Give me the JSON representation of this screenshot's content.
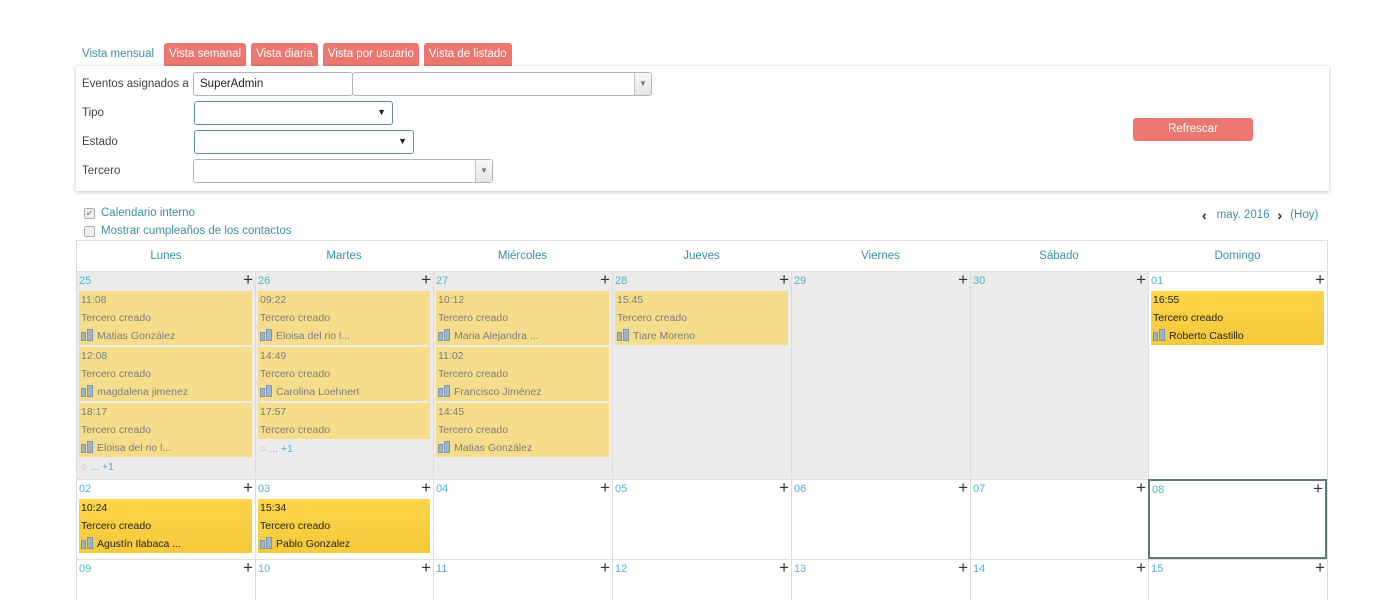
{
  "tabs": [
    {
      "label": "Vista mensual",
      "active": false
    },
    {
      "label": "Vista semanal",
      "active": true
    },
    {
      "label": "Vista diaria",
      "active": true
    },
    {
      "label": "Vista por usuario",
      "active": true
    },
    {
      "label": "Vista de listado",
      "active": true
    }
  ],
  "filters": {
    "assigned_label": "Eventos asignados a",
    "assigned_value": "SuperAdmin",
    "type_label": "Tipo",
    "status_label": "Estado",
    "third_label": "Tercero",
    "refresh_label": "Refrescar"
  },
  "options": {
    "internal_calendar": "Calendario interno",
    "birthdays": "Mostrar cumpleaños de los contactos"
  },
  "nav": {
    "month": "may. 2016",
    "today": "(Hoy)"
  },
  "weekdays": [
    "Lunes",
    "Martes",
    "Miércoles",
    "Jueves",
    "Viernes",
    "Sábado",
    "Domingo"
  ],
  "weeks": [
    [
      "25",
      "26",
      "27",
      "28",
      "29",
      "30",
      "01"
    ],
    [
      "02",
      "03",
      "04",
      "05",
      "06",
      "07",
      "08"
    ],
    [
      "09",
      "10",
      "11",
      "12",
      "13",
      "14",
      "15"
    ]
  ],
  "events": {
    "w0d0": [
      {
        "time": "11:08",
        "title": "Tercero creado",
        "who": "Matias González"
      },
      {
        "time": "12:08",
        "title": "Tercero creado",
        "who": "magdalena jimenez"
      },
      {
        "time": "18:17",
        "title": "Tercero creado",
        "who": "Eloisa del rio l..."
      }
    ],
    "w0d1": [
      {
        "time": "09:22",
        "title": "Tercero creado",
        "who": "Eloisa del rio l..."
      },
      {
        "time": "14:49",
        "title": "Tercero creado",
        "who": "Carolina Loehnert"
      },
      {
        "time": "17:57",
        "title": "Tercero creado",
        "who": ""
      }
    ],
    "w0d2": [
      {
        "time": "10:12",
        "title": "Tercero creado",
        "who": "Maria Alejandra ..."
      },
      {
        "time": "11:02",
        "title": "Tercero creado",
        "who": "Francisco Jiménez"
      },
      {
        "time": "14:45",
        "title": "Tercero creado",
        "who": "Matias González"
      }
    ],
    "w0d3": [
      {
        "time": "15:45",
        "title": "Tercero creado",
        "who": "Tiare Moreno"
      }
    ],
    "w0d6": [
      {
        "time": "16:55",
        "title": "Tercero creado",
        "who": "Roberto Castillo"
      }
    ],
    "w1d0": [
      {
        "time": "10:24",
        "title": "Tercero creado",
        "who": "Agustín Ilabaca ..."
      }
    ],
    "w1d1": [
      {
        "time": "15:34",
        "title": "Tercero creado",
        "who": "Pablo Gonzalez"
      }
    ]
  },
  "more_links": {
    "w0d0": "... +1",
    "w0d1": "... +1"
  },
  "colors": {
    "accent": "#ec7770",
    "link": "#3b8fa6",
    "day_number": "#4bb6c9",
    "event_past": "#f6dd8c",
    "event_future": "#fdd54a",
    "past_cell": "#ebebeb"
  }
}
